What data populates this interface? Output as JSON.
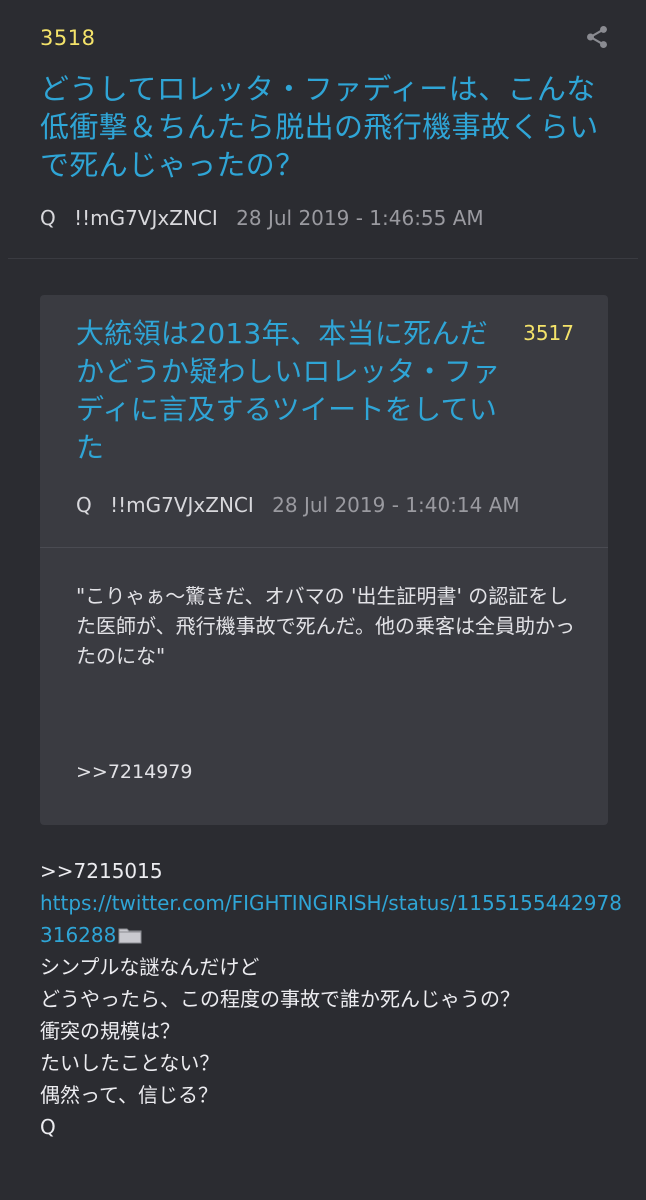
{
  "post": {
    "number": "3518",
    "title": "どうしてロレッタ・ファディーは、こんな低衝撃＆ちんたら脱出の飛行機事故くらいで死んじゃったの？",
    "author": "Q",
    "tripcode": "!!mG7VJxZNCI",
    "timestamp": "28 Jul 2019 - 1:46:55 AM"
  },
  "quote": {
    "number": "3517",
    "title": "大統領は2013年、本当に死んだかどうか疑わしいロレッタ・ファディに言及するツイートをしていた",
    "author": "Q",
    "tripcode": "!!mG7VJxZNCI",
    "timestamp": "28 Jul 2019 - 1:40:14 AM",
    "body": "\"こりゃぁ〜驚きだ、オバマの '出生証明書' の認証をした医師が、飛行機事故で死んだ。他の乗客は全員助かったのにな\"",
    "reference": ">>7214979"
  },
  "body": {
    "reference": ">>7215015",
    "link": "https://twitter.com/FIGHTINGIRISH/status/1155155442978316288",
    "lines": [
      "シンプルな謎なんだけど",
      "どうやったら、この程度の事故で誰か死んじゃうの？",
      "衝突の規模は？",
      "たいしたことない？",
      "偶然って、信じる？",
      "Q"
    ]
  },
  "icons": {
    "share": "share-icon",
    "folder": "folder-icon"
  },
  "colors": {
    "background": "#2b2c31",
    "card": "#3a3b41",
    "title_blue": "#2fa5d6",
    "number_yellow": "#f4e36a",
    "meta_gray": "#9a9aa0"
  }
}
